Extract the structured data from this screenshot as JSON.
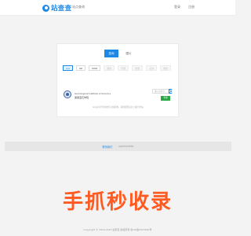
{
  "header": {
    "brand": "站查查",
    "tagline": "站点查询",
    "links": [
      "登录",
      "注册"
    ]
  },
  "card": {
    "tabs": [
      {
        "label": "查询",
        "active": true
      },
      {
        "label": "图片",
        "active": false
      }
    ],
    "chips": [
      {
        "label": "ICA",
        "state": "active"
      },
      {
        "label": "IGI",
        "state": "normal"
      },
      {
        "label": "ISSO",
        "state": "normal"
      },
      {
        "label": "其他",
        "state": "dim"
      },
      {
        "label": "高级",
        "state": "dim"
      },
      {
        "label": "批量",
        "state": "dim"
      },
      {
        "label": "证书",
        "state": "dim"
      },
      {
        "label": "报告",
        "state": "dim"
      }
    ],
    "org_name": "Gemological Institute of America",
    "org_cn": "美国宝石学院",
    "search_placeholder": "输入证书号",
    "submit_label": "查询",
    "description": "GIA证书号查询支持正规机构，请按照原证书上编号查询。"
  },
  "footer": {
    "links": [
      {
        "label": "联系我们",
        "style": "link"
      },
      {
        "label": "sponsorship",
        "style": "muted"
      }
    ],
    "watermark": "手抓秒收录",
    "copyright": "Copyright © 2016-2023 站查查 版权所有 鲁ICP备2023000号"
  }
}
